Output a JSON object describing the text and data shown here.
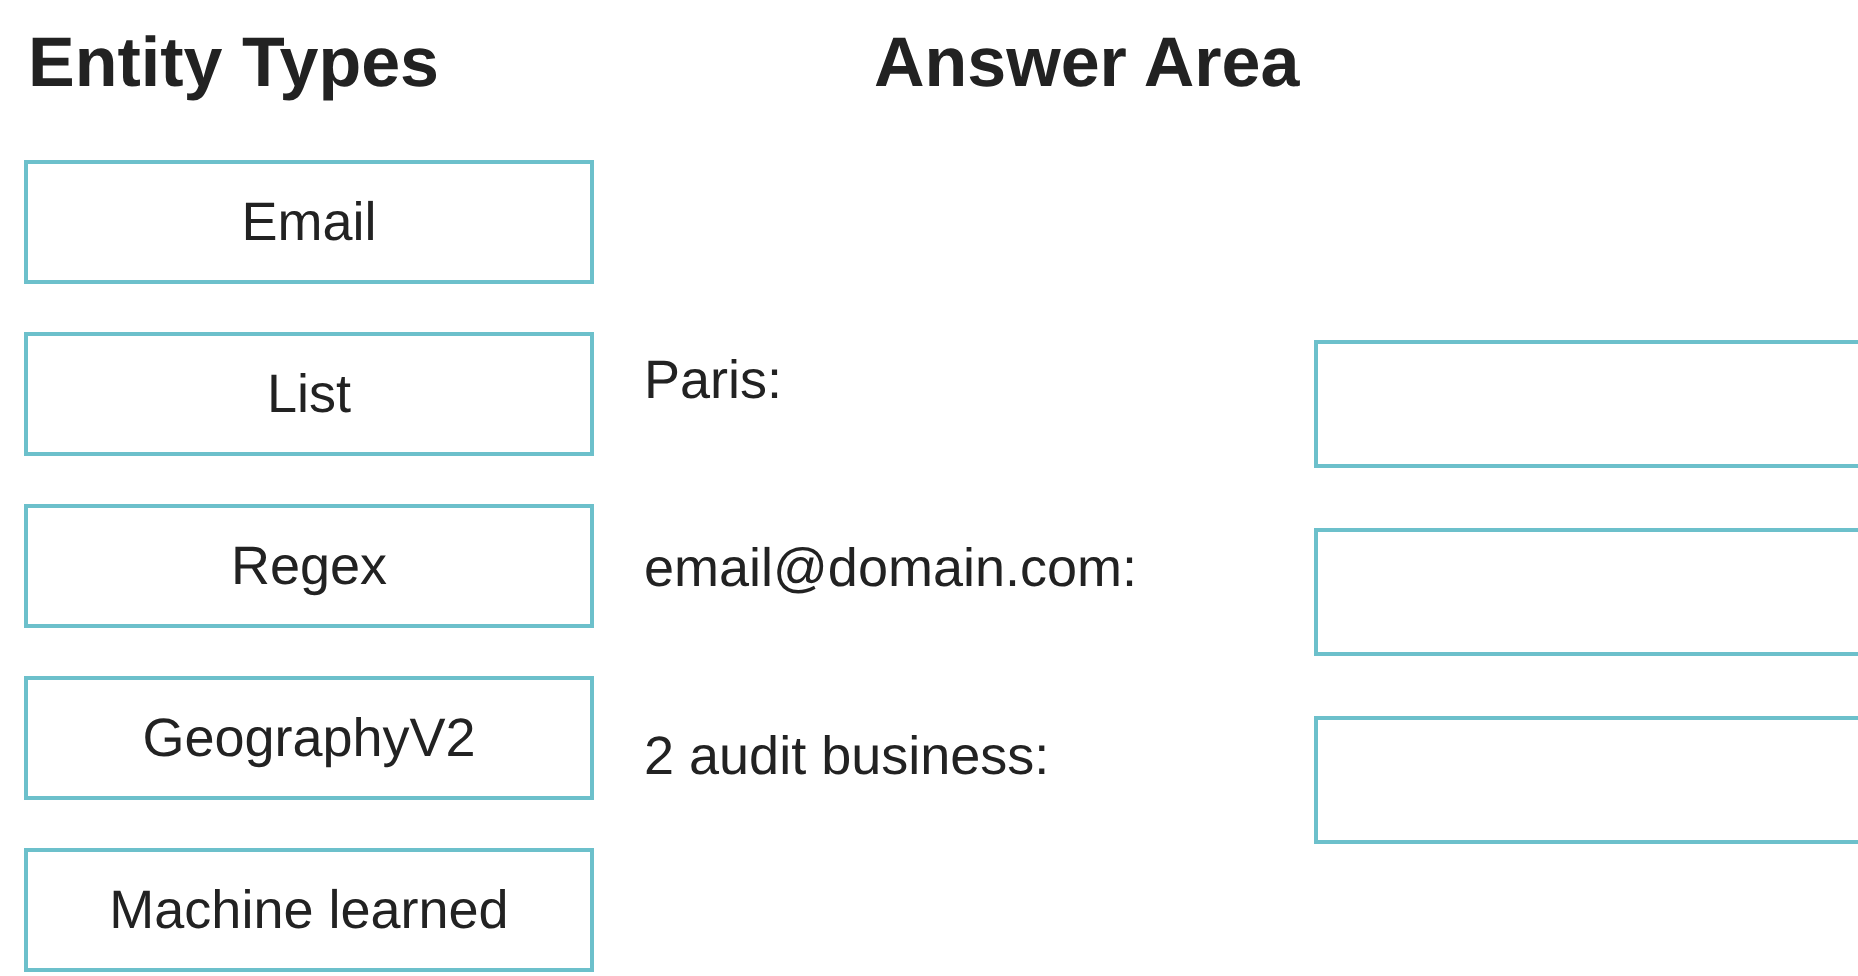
{
  "entity_types": {
    "title": "Entity Types",
    "items": [
      "Email",
      "List",
      "Regex",
      "GeographyV2",
      "Machine learned"
    ]
  },
  "answer_area": {
    "title": "Answer Area",
    "rows": [
      {
        "label": "Paris:"
      },
      {
        "label": "email@domain.com:"
      },
      {
        "label": "2 audit business:"
      }
    ]
  }
}
